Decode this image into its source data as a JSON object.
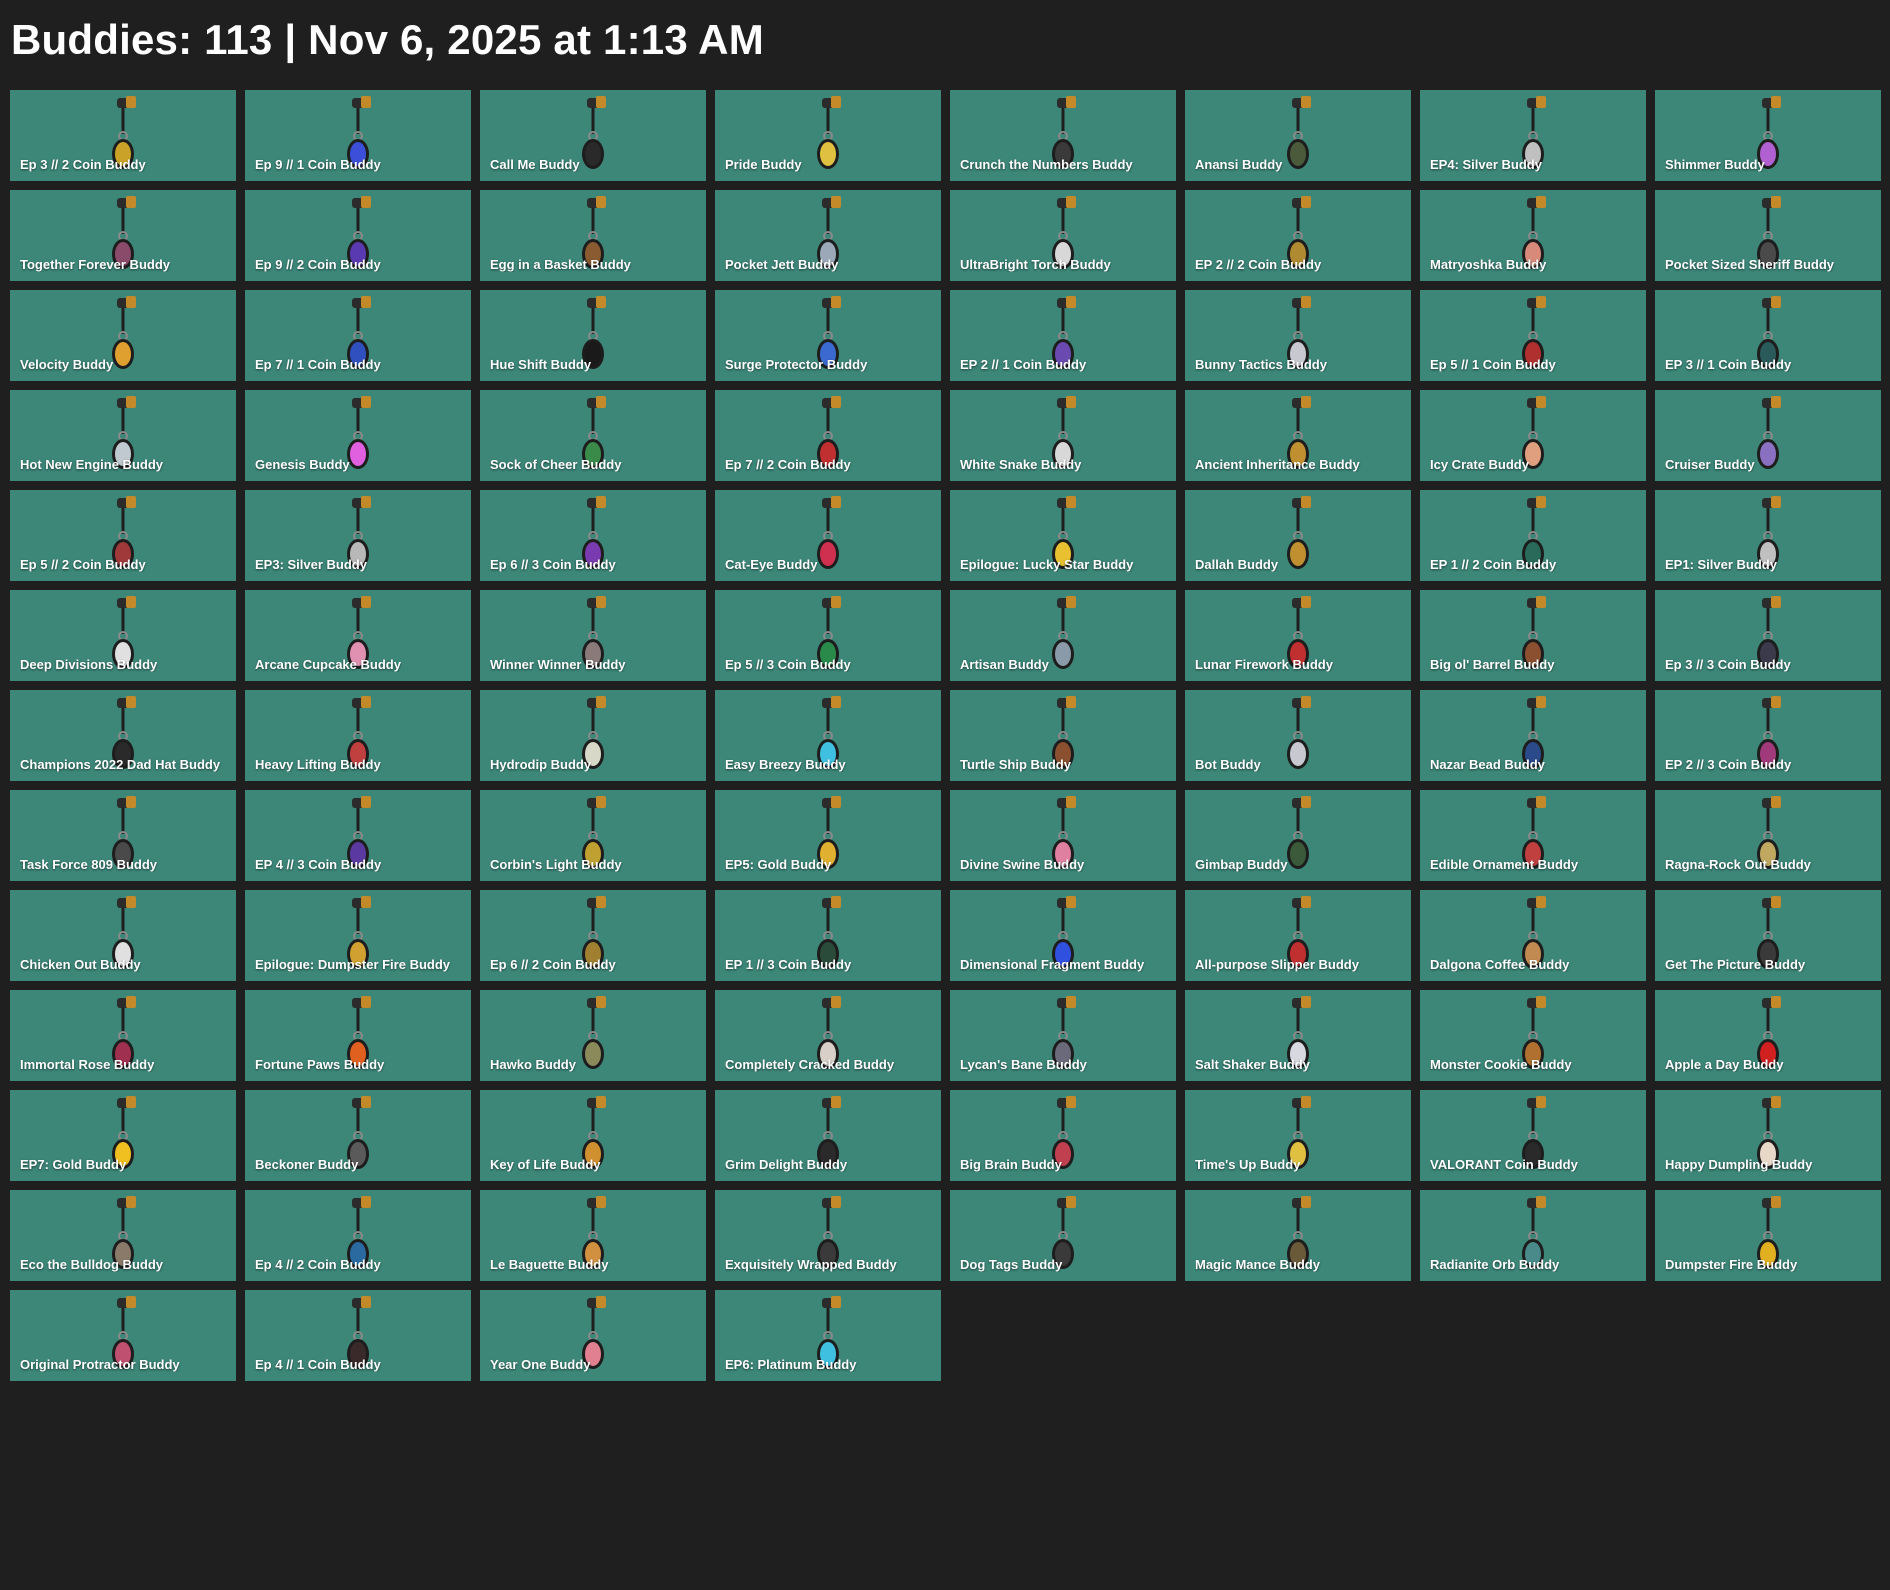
{
  "header": {
    "title": "Buddies: 113 | Nov 6, 2025 at 1:13 AM"
  },
  "theme": {
    "background": "#1f1f1f",
    "tile": "#3d8779",
    "text": "#ffffff"
  },
  "buddies": [
    {
      "name": "Ep 3 // 2 Coin Buddy",
      "icon": "coin-charm-icon",
      "color": "#c9a227"
    },
    {
      "name": "Ep 9 // 1 Coin Buddy",
      "icon": "coin-charm-icon",
      "color": "#3b4fd8"
    },
    {
      "name": "Call Me Buddy",
      "icon": "phone-charm-icon",
      "color": "#2a2a2a"
    },
    {
      "name": "Pride Buddy",
      "icon": "v-emblem-charm-icon",
      "color": "#e0c040"
    },
    {
      "name": "Crunch the Numbers Buddy",
      "icon": "calculator-charm-icon",
      "color": "#3a3a3a"
    },
    {
      "name": "Anansi Buddy",
      "icon": "spider-charm-icon",
      "color": "#4a5a3a"
    },
    {
      "name": "EP4: Silver Buddy",
      "icon": "silver-diamond-charm-icon",
      "color": "#c0c0c0"
    },
    {
      "name": "Shimmer Buddy",
      "icon": "shimmer-charm-icon",
      "color": "#b060d0"
    },
    {
      "name": "Together Forever Buddy",
      "icon": "heart-charm-icon",
      "color": "#8a4a6a"
    },
    {
      "name": "Ep 9 // 2 Coin Buddy",
      "icon": "coin-charm-icon",
      "color": "#5a3ab0"
    },
    {
      "name": "Egg in a Basket Buddy",
      "icon": "basket-charm-icon",
      "color": "#8a5a30"
    },
    {
      "name": "Pocket Jett Buddy",
      "icon": "figure-charm-icon",
      "color": "#9aa8b8"
    },
    {
      "name": "UltraBright Torch Buddy",
      "icon": "torch-charm-icon",
      "color": "#d8d8d8"
    },
    {
      "name": "EP 2 // 2 Coin Buddy",
      "icon": "coin-charm-icon",
      "color": "#b08a30"
    },
    {
      "name": "Matryoshka Buddy",
      "icon": "doll-charm-icon",
      "color": "#d88a7a"
    },
    {
      "name": "Pocket Sized Sheriff Buddy",
      "icon": "revolver-charm-icon",
      "color": "#4a4a4a"
    },
    {
      "name": "Velocity Buddy",
      "icon": "cup-charm-icon",
      "color": "#e0a030"
    },
    {
      "name": "Ep 7 // 1 Coin Buddy",
      "icon": "coin-charm-icon",
      "color": "#3050c0"
    },
    {
      "name": "Hue Shift Buddy",
      "icon": "orb-charm-icon",
      "color": "#1a1a1a"
    },
    {
      "name": "Surge Protector Buddy",
      "icon": "plug-charm-icon",
      "color": "#3a6ad0"
    },
    {
      "name": "EP 2 // 1 Coin Buddy",
      "icon": "coin-charm-icon",
      "color": "#6a4ab0"
    },
    {
      "name": "Bunny Tactics Buddy",
      "icon": "bunny-charm-icon",
      "color": "#c8c8d0"
    },
    {
      "name": "Ep 5 // 1 Coin Buddy",
      "icon": "coin-charm-icon",
      "color": "#b03030"
    },
    {
      "name": "EP 3 // 1 Coin Buddy",
      "icon": "coin-charm-icon",
      "color": "#2a5a5a"
    },
    {
      "name": "Hot New Engine Buddy",
      "icon": "engine-charm-icon",
      "color": "#c0c8d0"
    },
    {
      "name": "Genesis Buddy",
      "icon": "ring-charm-icon",
      "color": "#e060e0"
    },
    {
      "name": "Sock of Cheer Buddy",
      "icon": "sock-charm-icon",
      "color": "#3a8a4a"
    },
    {
      "name": "Ep 7 // 2 Coin Buddy",
      "icon": "coin-charm-icon",
      "color": "#c03030"
    },
    {
      "name": "White Snake Buddy",
      "icon": "snake-charm-icon",
      "color": "#d8d8d8"
    },
    {
      "name": "Ancient Inheritance Buddy",
      "icon": "mask-charm-icon",
      "color": "#c09030"
    },
    {
      "name": "Icy Crate Buddy",
      "icon": "crate-charm-icon",
      "color": "#e0a080"
    },
    {
      "name": "Cruiser Buddy",
      "icon": "lantern-charm-icon",
      "color": "#8a70c0"
    },
    {
      "name": "Ep 5 // 2 Coin Buddy",
      "icon": "coin-charm-icon",
      "color": "#a03a3a"
    },
    {
      "name": "EP3: Silver Buddy",
      "icon": "silver-diamond-charm-icon",
      "color": "#b8b8b8"
    },
    {
      "name": "Ep 6 // 3 Coin Buddy",
      "icon": "coin-charm-icon",
      "color": "#7a3ab0"
    },
    {
      "name": "Cat-Eye Buddy",
      "icon": "glasses-charm-icon",
      "color": "#d03050"
    },
    {
      "name": "Epilogue: Lucky Star Buddy",
      "icon": "star-charm-icon",
      "color": "#e8c030"
    },
    {
      "name": "Dallah Buddy",
      "icon": "teapot-charm-icon",
      "color": "#c09030"
    },
    {
      "name": "EP 1 // 2 Coin Buddy",
      "icon": "coin-charm-icon",
      "color": "#2a6a5a"
    },
    {
      "name": "EP1: Silver Buddy",
      "icon": "silver-diamond-charm-icon",
      "color": "#c0c0c0"
    },
    {
      "name": "Deep Divisions Buddy",
      "icon": "anchor-charm-icon",
      "color": "#e0e0e0"
    },
    {
      "name": "Arcane Cupcake Buddy",
      "icon": "cupcake-charm-icon",
      "color": "#e090b0"
    },
    {
      "name": "Winner Winner Buddy",
      "icon": "chicken-charm-icon",
      "color": "#8a7a7a"
    },
    {
      "name": "Ep 5 // 3 Coin Buddy",
      "icon": "coin-charm-icon",
      "color": "#2a8a4a"
    },
    {
      "name": "Artisan Buddy",
      "icon": "kettle-charm-icon",
      "color": "#8a9aa8"
    },
    {
      "name": "Lunar Firework Buddy",
      "icon": "firework-charm-icon",
      "color": "#c03030"
    },
    {
      "name": "Big ol' Barrel Buddy",
      "icon": "barrel-charm-icon",
      "color": "#8a5030"
    },
    {
      "name": "Ep 3 // 3 Coin Buddy",
      "icon": "coin-charm-icon",
      "color": "#3a3a4a"
    },
    {
      "name": "Champions 2022 Dad Hat Buddy",
      "icon": "hat-charm-icon",
      "color": "#2a2a2a"
    },
    {
      "name": "Heavy Lifting Buddy",
      "icon": "dumbbell-charm-icon",
      "color": "#c04040"
    },
    {
      "name": "Hydrodip Buddy",
      "icon": "bottle-charm-icon",
      "color": "#d8d8c8"
    },
    {
      "name": "Easy Breezy Buddy",
      "icon": "drink-charm-icon",
      "color": "#40c0e0"
    },
    {
      "name": "Turtle Ship Buddy",
      "icon": "ship-charm-icon",
      "color": "#8a5030"
    },
    {
      "name": "Bot Buddy",
      "icon": "robot-charm-icon",
      "color": "#c8c8d0"
    },
    {
      "name": "Nazar Bead Buddy",
      "icon": "bead-charm-icon",
      "color": "#2a4a8a"
    },
    {
      "name": "EP 2 // 3 Coin Buddy",
      "icon": "coin-charm-icon",
      "color": "#a03a7a"
    },
    {
      "name": "Task Force 809 Buddy",
      "icon": "tape-charm-icon",
      "color": "#4a4a4a"
    },
    {
      "name": "EP 4 // 3 Coin Buddy",
      "icon": "coin-charm-icon",
      "color": "#5a3aa0"
    },
    {
      "name": "Corbin's Light Buddy",
      "icon": "lamp-charm-icon",
      "color": "#c0a030"
    },
    {
      "name": "EP5: Gold Buddy",
      "icon": "gold-shield-charm-icon",
      "color": "#e0b030"
    },
    {
      "name": "Divine Swine Buddy",
      "icon": "pig-charm-icon",
      "color": "#e080a0"
    },
    {
      "name": "Gimbap Buddy",
      "icon": "gimbap-charm-icon",
      "color": "#3a5a3a"
    },
    {
      "name": "Edible Ornament Buddy",
      "icon": "candy-cane-charm-icon",
      "color": "#c04040"
    },
    {
      "name": "Ragna-Rock Out Buddy",
      "icon": "drums-charm-icon",
      "color": "#c0a860"
    },
    {
      "name": "Chicken Out Buddy",
      "icon": "chicken-charm-icon",
      "color": "#e0e0e0"
    },
    {
      "name": "Epilogue: Dumpster Fire Buddy",
      "icon": "dumpster-charm-icon",
      "color": "#d0a030"
    },
    {
      "name": "Ep 6 // 2 Coin Buddy",
      "icon": "coin-charm-icon",
      "color": "#a08030"
    },
    {
      "name": "EP 1 // 3 Coin Buddy",
      "icon": "coin-charm-icon",
      "color": "#2a4a3a"
    },
    {
      "name": "Dimensional Fragment Buddy",
      "icon": "crystal-charm-icon",
      "color": "#3050e0"
    },
    {
      "name": "All-purpose Slipper Buddy",
      "icon": "slipper-charm-icon",
      "color": "#c03030"
    },
    {
      "name": "Dalgona Coffee Buddy",
      "icon": "coffee-charm-icon",
      "color": "#c08a50"
    },
    {
      "name": "Get The Picture Buddy",
      "icon": "camera-charm-icon",
      "color": "#3a3a3a"
    },
    {
      "name": "Immortal Rose Buddy",
      "icon": "rose-charm-icon",
      "color": "#a03050"
    },
    {
      "name": "Fortune Paws Buddy",
      "icon": "cat-charm-icon",
      "color": "#e06020"
    },
    {
      "name": "Hawko Buddy",
      "icon": "bird-charm-icon",
      "color": "#8a8a5a"
    },
    {
      "name": "Completely Cracked Buddy",
      "icon": "egg-charm-icon",
      "color": "#d8d0c8"
    },
    {
      "name": "Lycan's Bane Buddy",
      "icon": "wolf-charm-icon",
      "color": "#6a6a7a"
    },
    {
      "name": "Salt Shaker Buddy",
      "icon": "shaker-charm-icon",
      "color": "#d8d8e0"
    },
    {
      "name": "Monster Cookie Buddy",
      "icon": "cookie-charm-icon",
      "color": "#b07030"
    },
    {
      "name": "Apple a Day Buddy",
      "icon": "apple-charm-icon",
      "color": "#d02020"
    },
    {
      "name": "EP7: Gold Buddy",
      "icon": "gold-shield-charm-icon",
      "color": "#f0c020"
    },
    {
      "name": "Beckoner Buddy",
      "icon": "ring-charm-icon",
      "color": "#5a5a5a"
    },
    {
      "name": "Key of Life Buddy",
      "icon": "ankh-charm-icon",
      "color": "#d09030"
    },
    {
      "name": "Grim Delight Buddy",
      "icon": "skull-charm-icon",
      "color": "#2a2a2a"
    },
    {
      "name": "Big Brain Buddy",
      "icon": "brain-charm-icon",
      "color": "#c04050"
    },
    {
      "name": "Time's Up Buddy",
      "icon": "hourglass-charm-icon",
      "color": "#e0c040"
    },
    {
      "name": "VALORANT Coin Buddy",
      "icon": "coin-charm-icon",
      "color": "#2a2a2a"
    },
    {
      "name": "Happy Dumpling Buddy",
      "icon": "dumpling-charm-icon",
      "color": "#e8d8c8"
    },
    {
      "name": "Eco the Bulldog Buddy",
      "icon": "dog-charm-icon",
      "color": "#8a7a6a"
    },
    {
      "name": "Ep 4 // 2 Coin Buddy",
      "icon": "coin-charm-icon",
      "color": "#2a6aa0"
    },
    {
      "name": "Le Baguette Buddy",
      "icon": "baguette-charm-icon",
      "color": "#d09040"
    },
    {
      "name": "Exquisitely Wrapped Buddy",
      "icon": "gift-charm-icon",
      "color": "#3a3a3a"
    },
    {
      "name": "Dog Tags Buddy",
      "icon": "tag-charm-icon",
      "color": "#3a3a3a"
    },
    {
      "name": "Magic Mance Buddy",
      "icon": "mage-charm-icon",
      "color": "#6a5a3a"
    },
    {
      "name": "Radianite Orb Buddy",
      "icon": "orb-charm-icon",
      "color": "#4a8a8a"
    },
    {
      "name": "Dumpster Fire Buddy",
      "icon": "dumpster-charm-icon",
      "color": "#e0b020"
    },
    {
      "name": "Original Protractor Buddy",
      "icon": "protractor-charm-icon",
      "color": "#c05070"
    },
    {
      "name": "Ep 4 // 1 Coin Buddy",
      "icon": "coin-charm-icon",
      "color": "#3a2a2a"
    },
    {
      "name": "Year One Buddy",
      "icon": "cake-charm-icon",
      "color": "#e08090"
    },
    {
      "name": "EP6: Platinum Buddy",
      "icon": "platinum-charm-icon",
      "color": "#40c0e0"
    }
  ]
}
